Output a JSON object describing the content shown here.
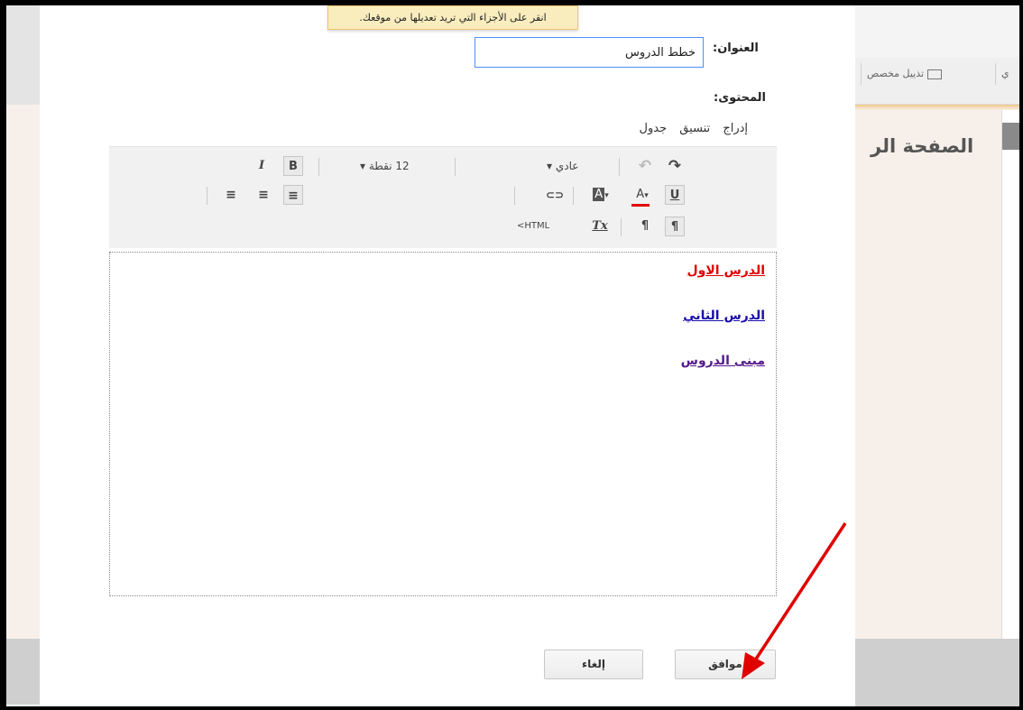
{
  "tooltip": "انقر على الأجزاء التي تريد تعديلها من موقعك.",
  "dialog": {
    "title_label": "العنوان:",
    "title_value": "خطط الدروس",
    "content_label": "المحتوى:",
    "menu": [
      "إدراج",
      "تنسيق",
      "جدول"
    ],
    "toolbar": {
      "redo": "↷",
      "undo": "↶",
      "style_select": "عادي",
      "font_size_select": "12 نقطة",
      "bold": "B",
      "italic": "I",
      "underline": "U",
      "text_color": "A",
      "bg_color": "A",
      "link": "⊂⊃",
      "html_label": "HTML>",
      "clear_format": "Tx",
      "text_color_accent": "#e00000"
    },
    "content_links": [
      {
        "text": "الدرس الاول",
        "color": "#e00000"
      },
      {
        "text": "الدرس الثاني",
        "color": "#1a0dab"
      },
      {
        "text": "مبنى الدروس",
        "color": "#551a8b"
      }
    ],
    "ok_button": "موافق",
    "cancel_button": "إلغاء"
  },
  "background": {
    "toolbar_item_1": "تذييل مخصص",
    "toolbar_item_2": "ي",
    "page_title": "الصفحة الر"
  },
  "annotation": {
    "arrow_color": "#e00000"
  }
}
